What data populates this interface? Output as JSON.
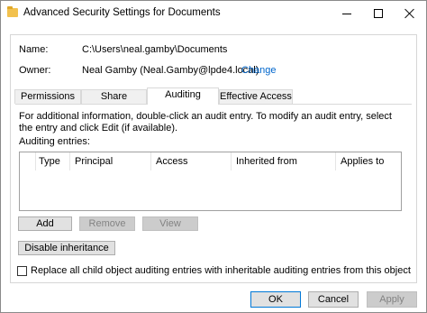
{
  "window": {
    "title": "Advanced Security Settings for Documents"
  },
  "info": {
    "name_label": "Name:",
    "name_value": "C:\\Users\\neal.gamby\\Documents",
    "owner_label": "Owner:",
    "owner_value": "Neal Gamby (Neal.Gamby@lpde4.local)",
    "change_link": "Change"
  },
  "tabs": [
    {
      "label": "Permissions",
      "active": false
    },
    {
      "label": "Share",
      "active": false
    },
    {
      "label": "Auditing",
      "active": true
    },
    {
      "label": "Effective Access",
      "active": false
    }
  ],
  "auditing": {
    "description": "For additional information, double-click an audit entry. To modify an audit entry, select the entry and click Edit (if available).",
    "entries_label": "Auditing entries:",
    "columns": [
      "Type",
      "Principal",
      "Access",
      "Inherited from",
      "Applies to"
    ],
    "rows": [],
    "add_label": "Add",
    "remove_label": "Remove",
    "view_label": "View",
    "disable_inheritance_label": "Disable inheritance",
    "replace_checkbox_label": "Replace all child object auditing entries with inheritable auditing entries from this object",
    "replace_checked": false
  },
  "footer": {
    "ok_label": "OK",
    "cancel_label": "Cancel",
    "apply_label": "Apply"
  },
  "colors": {
    "link": "#0066cc",
    "primary_border": "#0078d7",
    "folder_icon": "#f2c14e"
  }
}
